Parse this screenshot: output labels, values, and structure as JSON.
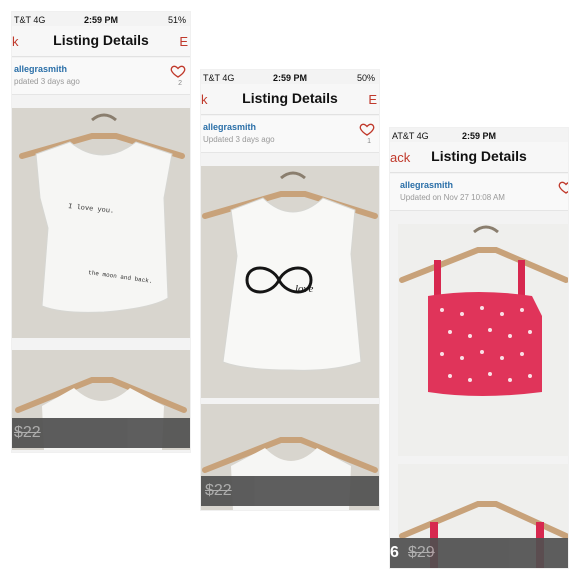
{
  "screens": [
    {
      "carrier": "T&T 4G",
      "time": "2:59 PM",
      "battery": "51%",
      "back_label": "k",
      "title": "Listing Details",
      "edit_label": "E",
      "username": "allegrasmith",
      "posted": "pdated 3 days ago",
      "likes": "2",
      "price": "",
      "original_price": "$22",
      "shirt_print_1": "I love you.",
      "shirt_print_2": "the moon and back."
    },
    {
      "carrier": "T&T 4G",
      "time": "2:59 PM",
      "battery": "50%",
      "back_label": "k",
      "title": "Listing Details",
      "edit_label": "E",
      "username": "allegrasmith",
      "posted": "Updated 3 days ago",
      "likes": "1",
      "price": "",
      "original_price": "$22",
      "shirt_print": "love"
    },
    {
      "carrier": "AT&T 4G",
      "time": "2:59 PM",
      "battery": "",
      "back_label": "ack",
      "title": "Listing Details",
      "username": "allegrasmith",
      "posted": "Updated on Nov 27 10:08 AM",
      "price": "6",
      "original_price": "$29"
    }
  ],
  "colors": {
    "accent": "#c0392b",
    "username": "#2a6fa8",
    "crop_top": "#e0345a"
  }
}
